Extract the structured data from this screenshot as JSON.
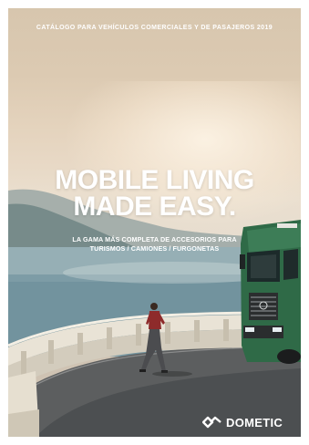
{
  "cover": {
    "topline": "CATÁLOGO PARA VEHÍCULOS COMERCIALES Y DE PASAJEROS 2019",
    "headline_line1": "MOBILE LIVING",
    "headline_line2": "MADE EASY.",
    "sub_line1": "LA GAMA MÁS COMPLETA DE ACCESORIOS PARA",
    "sub_line2": "TURISMOS / CAMIONES / FURGONETAS",
    "brand": "DOMETIC"
  },
  "colors": {
    "text": "#ffffff",
    "truck": "#2f6a47",
    "sea": "#7f9ea8",
    "sky": "#e4d3bd"
  }
}
